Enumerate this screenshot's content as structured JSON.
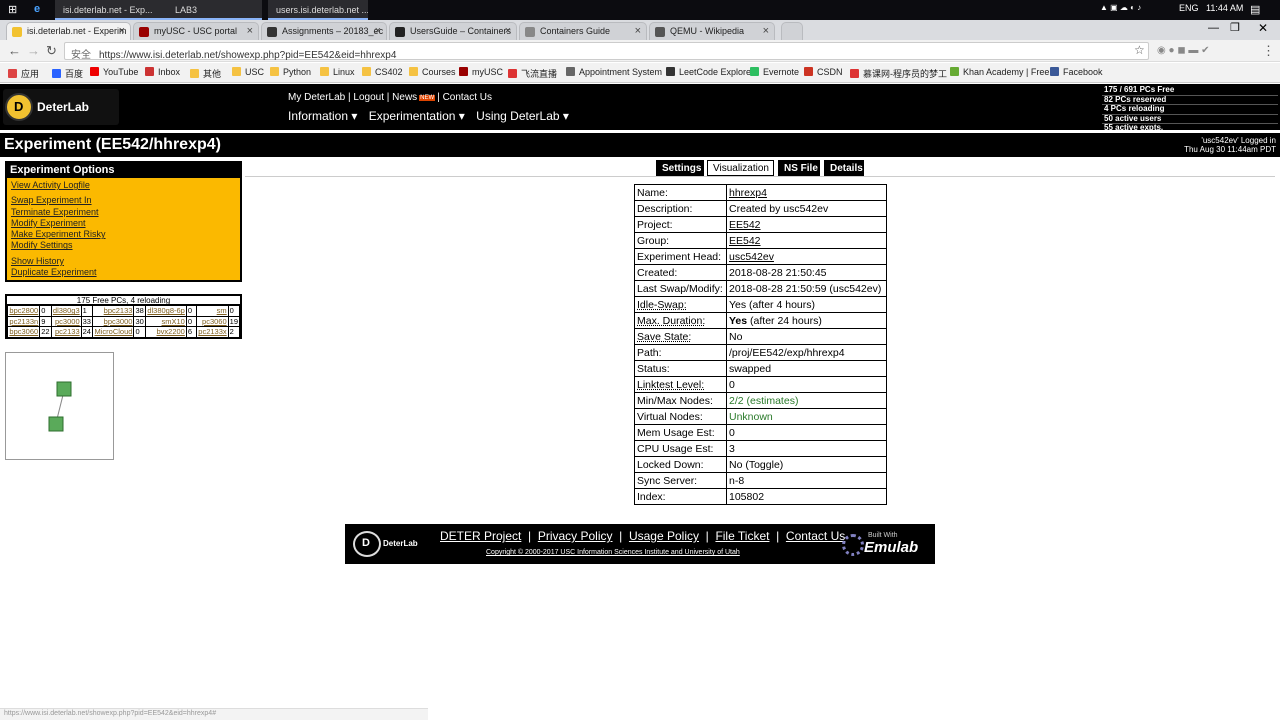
{
  "taskbar": {
    "windows": [
      "isi.deterlab.net - Exp...",
      "LAB3",
      "users.isi.deterlab.net ..."
    ],
    "tray": {
      "lang": "ENG",
      "time": "11:44 AM"
    }
  },
  "tabs": [
    {
      "label": "isi.deterlab.net - Experim",
      "color": "#f2c230"
    },
    {
      "label": "myUSC - USC portal",
      "color": "#990000"
    },
    {
      "label": "Assignments – 20183_ec",
      "color": "#333333"
    },
    {
      "label": "UsersGuide – Containers",
      "color": "#222222"
    },
    {
      "label": "Containers Guide",
      "color": "#888888"
    },
    {
      "label": "QEMU - Wikipedia",
      "color": "#555555"
    }
  ],
  "address": {
    "security": "安全",
    "url": "https://www.isi.deterlab.net/showexp.php?pid=EE542&eid=hhrexp4"
  },
  "bookmarks": [
    {
      "label": "应用",
      "color": "#d44"
    },
    {
      "label": "百度",
      "color": "#2962ff"
    },
    {
      "label": "YouTube",
      "color": "#e00"
    },
    {
      "label": "Inbox",
      "color": "#c33"
    },
    {
      "label": "其他",
      "color": "#f5c242"
    },
    {
      "label": "USC",
      "color": "#f5c242"
    },
    {
      "label": "Python",
      "color": "#f5c242"
    },
    {
      "label": "Linux",
      "color": "#f5c242"
    },
    {
      "label": "CS402",
      "color": "#f5c242"
    },
    {
      "label": "Courses",
      "color": "#f5c242"
    },
    {
      "label": "myUSC",
      "color": "#990000"
    },
    {
      "label": "飞流直播",
      "color": "#d33"
    },
    {
      "label": "Appointment System",
      "color": "#666"
    },
    {
      "label": "LeetCode Explore",
      "color": "#333"
    },
    {
      "label": "Evernote",
      "color": "#2dbe60"
    },
    {
      "label": "CSDN",
      "color": "#c32"
    },
    {
      "label": "慕课网-程序员的梦工",
      "color": "#d33"
    },
    {
      "label": "Khan Academy | Free",
      "color": "#6a3"
    },
    {
      "label": "Facebook",
      "color": "#3b5998"
    }
  ],
  "deter": {
    "logo_text": "DeterLab",
    "logo_letter": "D",
    "toplinks": [
      "My DeterLab",
      "Logout",
      "News",
      "Contact Us"
    ],
    "new_tag": "NEW",
    "menus": [
      "Information ▾",
      "Experimentation ▾",
      "Using DeterLab ▾"
    ],
    "stats": [
      "175 / 691 PCs Free",
      "82 PCs reserved",
      "4 PCs reloading",
      "50 active users",
      "55 active expts."
    ]
  },
  "title": "Experiment (EE542/hhrexp4)",
  "login": {
    "line1": "'usc542ev' Logged in",
    "line2": "Thu Aug 30 11:44am PDT"
  },
  "options": {
    "header": "Experiment Options",
    "items": [
      {
        "label": "View Activity Logfile",
        "gap_before": false
      },
      {
        "label": "Swap Experiment In",
        "gap_before": true
      },
      {
        "label": "Terminate Experiment",
        "gap_before": false
      },
      {
        "label": "Modify Experiment",
        "gap_before": false
      },
      {
        "label": "Make Experiment Risky",
        "gap_before": false
      },
      {
        "label": "Modify Settings",
        "gap_before": false
      },
      {
        "label": "Show History",
        "gap_before": true
      },
      {
        "label": "Duplicate Experiment",
        "gap_before": false
      }
    ]
  },
  "pcs": {
    "header": "175 Free PCs, 4 reloading",
    "rows": [
      [
        [
          "bpc2800",
          "0"
        ],
        [
          "dl380g3",
          "1"
        ],
        [
          "bpc2133",
          "38"
        ],
        [
          "dl380g8-6p",
          "0"
        ],
        [
          "sm",
          "0"
        ]
      ],
      [
        [
          "pc2133n",
          "9"
        ],
        [
          "pc3000",
          "33"
        ],
        [
          "bpc3000",
          "30"
        ],
        [
          "smX10",
          "0"
        ],
        [
          "pc3060",
          "19"
        ]
      ],
      [
        [
          "bpc3060",
          "22"
        ],
        [
          "pc2133",
          "24"
        ],
        [
          "MicroCloud",
          "0"
        ],
        [
          "bvx2200",
          "6"
        ],
        [
          "pc2133x",
          "2"
        ]
      ]
    ]
  },
  "subtabs": [
    "Settings",
    "Visualization",
    "NS File",
    "Details"
  ],
  "info": [
    {
      "k": "Name:",
      "v": "hhrexp4",
      "ks": "",
      "vs": "u"
    },
    {
      "k": "Description:",
      "v": "Created by usc542ev",
      "ks": "",
      "vs": ""
    },
    {
      "k": "Project:",
      "v": "EE542",
      "ks": "",
      "vs": "u"
    },
    {
      "k": "Group:",
      "v": "EE542",
      "ks": "",
      "vs": "u"
    },
    {
      "k": "Experiment Head:",
      "v": "usc542ev",
      "ks": "",
      "vs": "u"
    },
    {
      "k": "Created:",
      "v": "2018-08-28 21:50:45",
      "ks": "",
      "vs": ""
    },
    {
      "k": "Last Swap/Modify:",
      "v": "2018-08-28 21:50:59 (usc542ev)",
      "ks": "",
      "vs": ""
    },
    {
      "k": "Idle-Swap:",
      "v": "Yes (after 4 hours)",
      "ks": "ud",
      "vs": ""
    },
    {
      "k": "Max. Duration:",
      "v": "(after 24 hours)",
      "vb": "Yes",
      "ks": "ud",
      "vs": ""
    },
    {
      "k": "Save State:",
      "v": "No",
      "ks": "ud",
      "vs": ""
    },
    {
      "k": "Path:",
      "v": "/proj/EE542/exp/hhrexp4",
      "ks": "",
      "vs": ""
    },
    {
      "k": "Status:",
      "v": "swapped",
      "ks": "",
      "vs": ""
    },
    {
      "k": "Linktest Level:",
      "v": "0",
      "ks": "ud",
      "vs": ""
    },
    {
      "k": "Min/Max Nodes:",
      "v": "2/2 (estimates)",
      "ks": "",
      "vs": "g"
    },
    {
      "k": "Virtual Nodes:",
      "v": "Unknown",
      "ks": "",
      "vs": "g"
    },
    {
      "k": "Mem Usage Est:",
      "v": "0",
      "ks": "",
      "vs": ""
    },
    {
      "k": "CPU Usage Est:",
      "v": "3",
      "ks": "",
      "vs": ""
    },
    {
      "k": "Locked Down:",
      "v": "No (Toggle)",
      "ks": "",
      "vs": ""
    },
    {
      "k": "Sync Server:",
      "v": "n-8",
      "ks": "",
      "vs": ""
    },
    {
      "k": "Index:",
      "v": "105802",
      "ks": "",
      "vs": ""
    }
  ],
  "footer": {
    "links": [
      "DETER Project",
      "Privacy Policy",
      "Usage Policy",
      "File Ticket",
      "Contact Us"
    ],
    "copyright": "Copyright © 2000-2017 USC Information Sciences Institute and University of Utah",
    "built_with": "Built With",
    "emulab": "Emulab",
    "logo_text": "DeterLab",
    "logo_letter": "D"
  },
  "status_url": "https://www.isi.deterlab.net/showexp.php?pid=EE542&eid=hhrexp4#"
}
